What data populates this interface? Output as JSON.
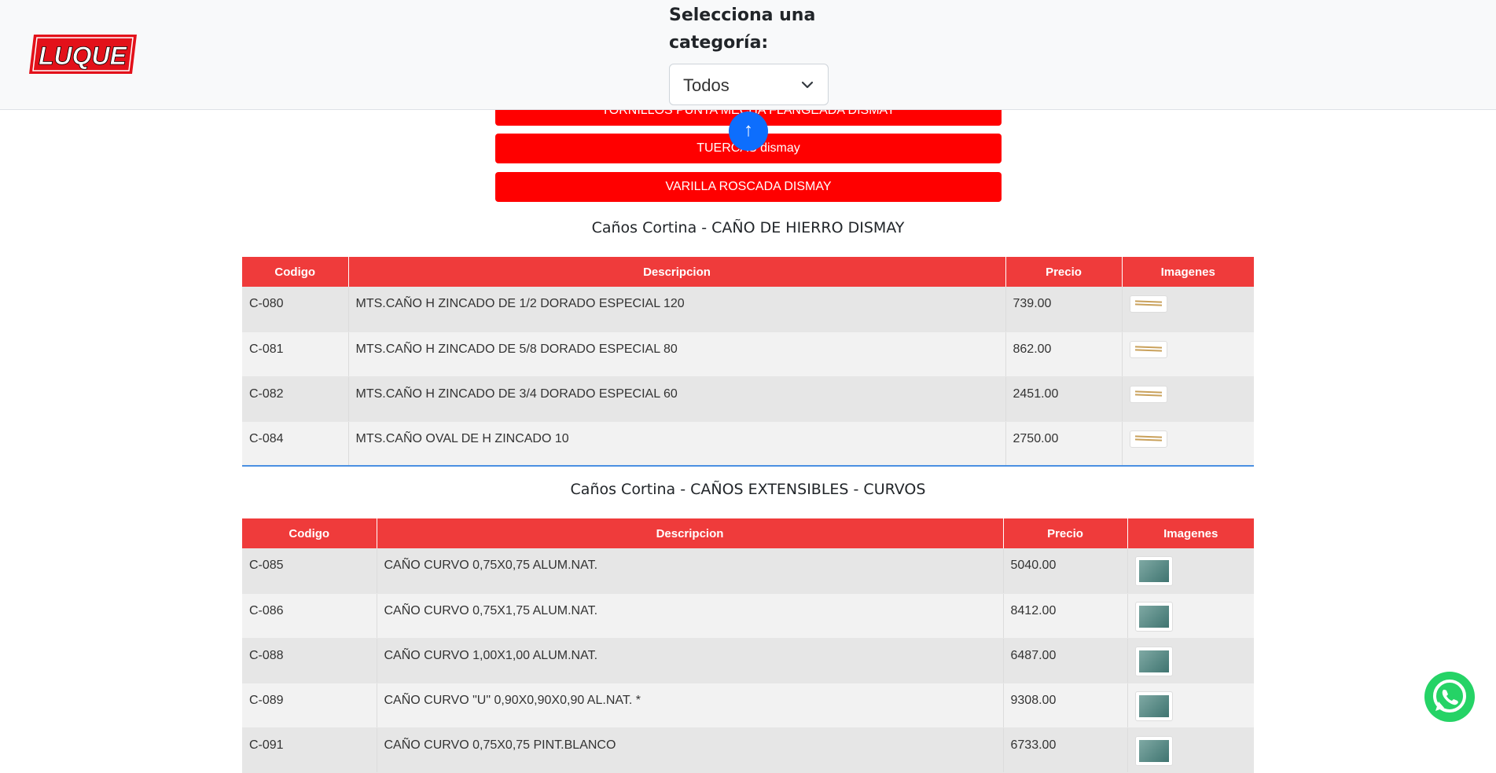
{
  "header": {
    "logo_text": "LUQUE",
    "category_title": "Selecciona una categoría:",
    "category_select_value": "Todos"
  },
  "category_buttons": [
    "TORNILLOS PUNTA MECHA FLANGEADA DISMAY",
    "TUERCAS dismay",
    "VARILLA ROSCADA DISMAY"
  ],
  "scroll_top_icon": "↑",
  "columns": {
    "code": "Codigo",
    "description": "Descripcion",
    "price": "Precio",
    "images": "Imagenes"
  },
  "sections": [
    {
      "title": "Caños Cortina - CAÑO DE HIERRO DISMAY",
      "rows": [
        {
          "code": "C-080",
          "description": "MTS.CAÑO H ZINCADO DE 1/2 DORADO ESPECIAL 120",
          "price": "739.00"
        },
        {
          "code": "C-081",
          "description": "MTS.CAÑO H ZINCADO DE 5/8 DORADO ESPECIAL 80",
          "price": "862.00"
        },
        {
          "code": "C-082",
          "description": "MTS.CAÑO H ZINCADO DE 3/4 DORADO ESPECIAL 60",
          "price": "2451.00"
        },
        {
          "code": "C-084",
          "description": "MTS.CAÑO OVAL DE H ZINCADO 10",
          "price": "2750.00"
        }
      ]
    },
    {
      "title": "Caños Cortina - CAÑOS EXTENSIBLES - CURVOS",
      "rows": [
        {
          "code": "C-085",
          "description": "CAÑO CURVO 0,75X0,75 ALUM.NAT.",
          "price": "5040.00"
        },
        {
          "code": "C-086",
          "description": "CAÑO CURVO 0,75X1,75 ALUM.NAT.",
          "price": "8412.00"
        },
        {
          "code": "C-088",
          "description": "CAÑO CURVO 1,00X1,00 ALUM.NAT.",
          "price": "6487.00"
        },
        {
          "code": "C-089",
          "description": "CAÑO CURVO \"U\" 0,90X0,90X0,90 AL.NAT. *",
          "price": "9308.00"
        },
        {
          "code": "C-091",
          "description": "CAÑO CURVO 0,75X0,75 PINT.BLANCO",
          "price": "6733.00"
        }
      ]
    }
  ],
  "colors": {
    "button_red": "#ff0000",
    "table_header_red": "#ef3b3b",
    "scroll_blue": "#0d6efd",
    "whatsapp_green": "#25d366"
  },
  "icons": {
    "scroll_top": "arrow-up-icon",
    "whatsapp": "whatsapp-icon",
    "select_arrow": "chevron-down-icon"
  }
}
